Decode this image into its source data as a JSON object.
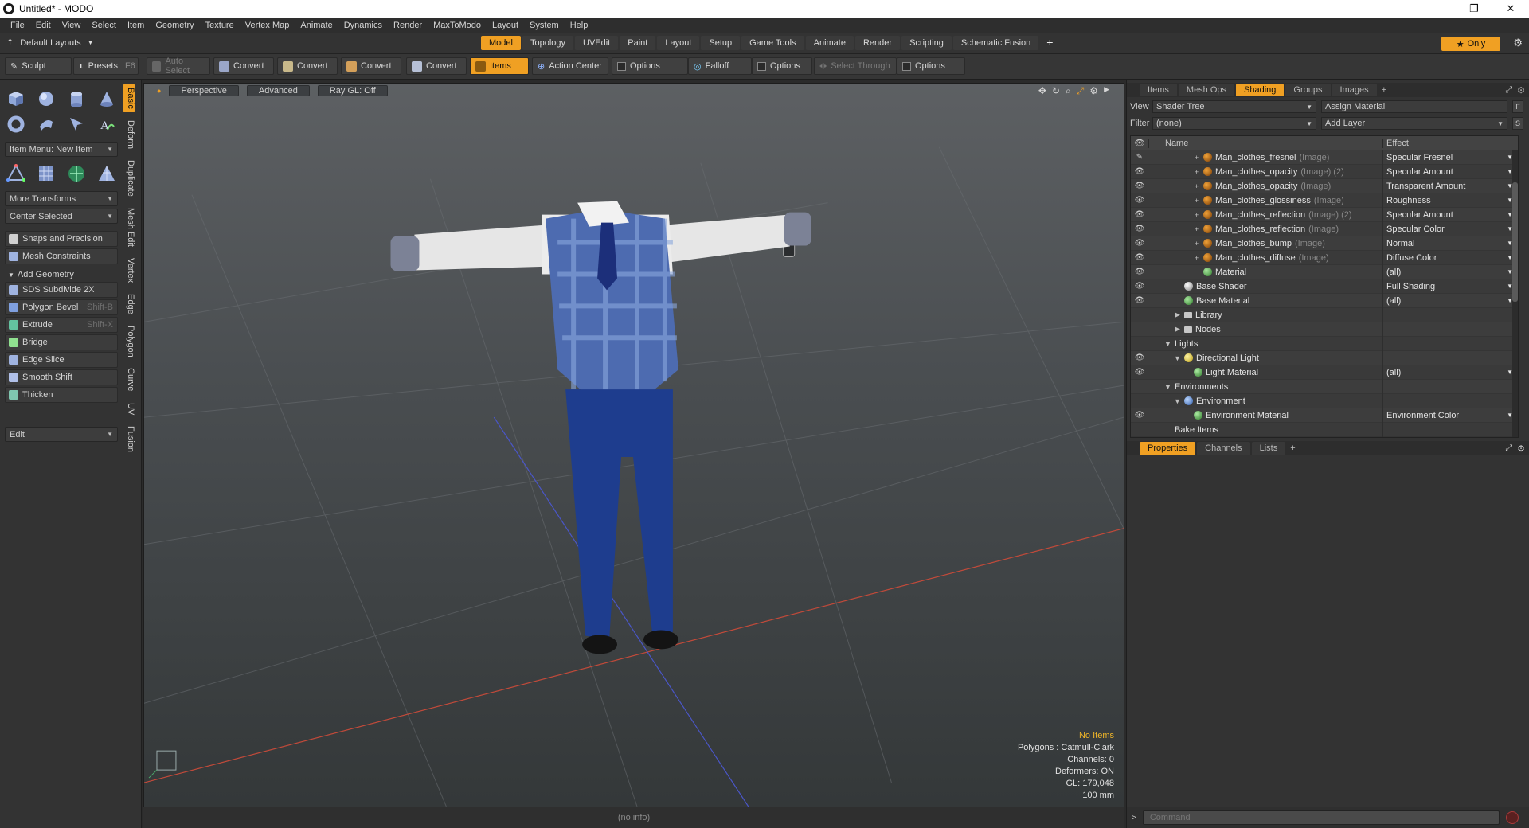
{
  "window": {
    "title": "Untitled* - MODO",
    "minimize": "–",
    "maximize": "❐",
    "close": "✕"
  },
  "menubar": [
    "File",
    "Edit",
    "View",
    "Select",
    "Item",
    "Geometry",
    "Texture",
    "Vertex Map",
    "Animate",
    "Dynamics",
    "Render",
    "MaxToModo",
    "Layout",
    "System",
    "Help"
  ],
  "layoutbar": {
    "layout_label": "Default Layouts",
    "tabs": [
      "Model",
      "Topology",
      "UVEdit",
      "Paint",
      "Layout",
      "Setup",
      "Game Tools",
      "Animate",
      "Render",
      "Scripting",
      "Schematic Fusion"
    ],
    "active_tab": "Model",
    "only_label": "Only"
  },
  "toolbar": {
    "sculpt": "Sculpt",
    "presets": "Presets",
    "presets_shortcut": "F6",
    "auto_select": "Auto Select",
    "convert1": "Convert",
    "convert2": "Convert",
    "convert3": "Convert",
    "convert4": "Convert",
    "items": "Items",
    "action_center": "Action Center",
    "options1": "Options",
    "falloff": "Falloff",
    "options2": "Options",
    "select_through": "Select Through",
    "options3": "Options"
  },
  "leftpanel": {
    "item_menu": "Item Menu: New Item",
    "more_transforms": "More Transforms",
    "center_selected": "Center Selected",
    "snaps": "Snaps and Precision",
    "mesh_constraints": "Mesh Constraints",
    "add_geometry": "Add Geometry",
    "tools": [
      {
        "label": "SDS Subdivide 2X",
        "shortcut": ""
      },
      {
        "label": "Polygon Bevel",
        "shortcut": "Shift-B"
      },
      {
        "label": "Extrude",
        "shortcut": "Shift-X"
      },
      {
        "label": "Bridge",
        "shortcut": ""
      },
      {
        "label": "Edge Slice",
        "shortcut": ""
      },
      {
        "label": "Smooth Shift",
        "shortcut": ""
      },
      {
        "label": "Thicken",
        "shortcut": ""
      }
    ],
    "edit_dropdown": "Edit",
    "vertical_tabs": [
      "Basic",
      "Deform",
      "Duplicate",
      "Mesh Edit",
      "Vertex",
      "Edge",
      "Polygon",
      "Curve",
      "UV",
      "Fusion"
    ],
    "active_vtab": "Basic"
  },
  "viewport": {
    "perspective": "Perspective",
    "advanced": "Advanced",
    "raygl": "Ray GL: Off",
    "info": {
      "no_items": "No Items",
      "polygons": "Polygons : Catmull-Clark",
      "channels": "Channels: 0",
      "deformers": "Deformers: ON",
      "gl": "GL: 179,048",
      "scale": "100 mm"
    }
  },
  "statusbar": "(no info)",
  "rightpanel": {
    "top_tabs": [
      "Items",
      "Mesh Ops",
      "Shading",
      "Groups",
      "Images"
    ],
    "active_top_tab": "Shading",
    "view_label": "View",
    "view_value": "Shader Tree",
    "assign_material": "Assign Material",
    "filter_label": "Filter",
    "filter_value": "(none)",
    "add_layer": "Add Layer",
    "btn_f": "F",
    "btn_s": "S",
    "tree_header": {
      "name": "Name",
      "effect": "Effect"
    },
    "tree_rows": [
      {
        "indent": 4,
        "eye": "✎",
        "exp": "+",
        "icon": "image",
        "name": "Man_clothes_fresnel",
        "suffix": "(Image)",
        "effect": "Specular Fresnel",
        "dd": "▼"
      },
      {
        "indent": 4,
        "eye": "👁",
        "exp": "+",
        "icon": "image",
        "name": "Man_clothes_opacity",
        "suffix": "(Image) (2)",
        "effect": "Specular Amount",
        "dd": "▼"
      },
      {
        "indent": 4,
        "eye": "👁",
        "exp": "+",
        "icon": "image",
        "name": "Man_clothes_opacity",
        "suffix": "(Image)",
        "effect": "Transparent Amount",
        "dd": "▼"
      },
      {
        "indent": 4,
        "eye": "👁",
        "exp": "+",
        "icon": "image",
        "name": "Man_clothes_glossiness",
        "suffix": "(Image)",
        "effect": "Roughness",
        "dd": "▼"
      },
      {
        "indent": 4,
        "eye": "👁",
        "exp": "+",
        "icon": "image",
        "name": "Man_clothes_reflection",
        "suffix": "(Image) (2)",
        "effect": "Specular Amount",
        "dd": "▼"
      },
      {
        "indent": 4,
        "eye": "👁",
        "exp": "+",
        "icon": "image",
        "name": "Man_clothes_reflection",
        "suffix": "(Image)",
        "effect": "Specular Color",
        "dd": "▼"
      },
      {
        "indent": 4,
        "eye": "👁",
        "exp": "+",
        "icon": "image",
        "name": "Man_clothes_bump",
        "suffix": "(Image)",
        "effect": "Normal",
        "dd": "▼"
      },
      {
        "indent": 4,
        "eye": "👁",
        "exp": "+",
        "icon": "image",
        "name": "Man_clothes_diffuse",
        "suffix": "(Image)",
        "effect": "Diffuse Color",
        "dd": "▼"
      },
      {
        "indent": 4,
        "eye": "👁",
        "exp": "",
        "icon": "material",
        "name": "Material",
        "suffix": "",
        "effect": "(all)",
        "dd": "▼"
      },
      {
        "indent": 2,
        "eye": "👁",
        "exp": "",
        "icon": "shader",
        "name": "Base Shader",
        "suffix": "",
        "effect": "Full Shading",
        "dd": "▼"
      },
      {
        "indent": 2,
        "eye": "👁",
        "exp": "",
        "icon": "material",
        "name": "Base Material",
        "suffix": "",
        "effect": "(all)",
        "dd": "▼"
      },
      {
        "indent": 2,
        "eye": "",
        "exp": "▶",
        "icon": "",
        "name": "Library",
        "suffix": "",
        "effect": "",
        "dd": ""
      },
      {
        "indent": 2,
        "eye": "",
        "exp": "▶",
        "icon": "",
        "name": "Nodes",
        "suffix": "",
        "effect": "",
        "dd": ""
      },
      {
        "indent": 1,
        "eye": "",
        "exp": "▼",
        "icon": "",
        "name": "Lights",
        "suffix": "",
        "effect": "",
        "dd": ""
      },
      {
        "indent": 2,
        "eye": "👁",
        "exp": "▼",
        "icon": "light",
        "name": "Directional Light",
        "suffix": "",
        "effect": "",
        "dd": ""
      },
      {
        "indent": 3,
        "eye": "👁",
        "exp": "",
        "icon": "material",
        "name": "Light Material",
        "suffix": "",
        "effect": "(all)",
        "dd": "▼"
      },
      {
        "indent": 1,
        "eye": "",
        "exp": "▼",
        "icon": "",
        "name": "Environments",
        "suffix": "",
        "effect": "",
        "dd": ""
      },
      {
        "indent": 2,
        "eye": "",
        "exp": "▼",
        "icon": "env",
        "name": "Environment",
        "suffix": "",
        "effect": "",
        "dd": ""
      },
      {
        "indent": 3,
        "eye": "👁",
        "exp": "",
        "icon": "material",
        "name": "Environment Material",
        "suffix": "",
        "effect": "Environment Color",
        "dd": "▼"
      },
      {
        "indent": 1,
        "eye": "",
        "exp": "",
        "icon": "",
        "name": "Bake Items",
        "suffix": "",
        "effect": "",
        "dd": ""
      }
    ],
    "bottom_tabs": [
      "Properties",
      "Channels",
      "Lists"
    ],
    "active_bottom_tab": "Properties",
    "command_placeholder": "Command"
  },
  "colors": {
    "accent": "#f0a023",
    "panel": "#333333",
    "red_axis": "#c24a3a",
    "blue_axis": "#4a56c8"
  }
}
